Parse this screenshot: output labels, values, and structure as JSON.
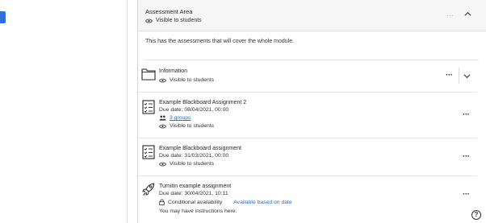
{
  "folder": {
    "title": "Assessment Area",
    "visibility": "Visible to students",
    "description": "This has the assessments that will cover the whole module."
  },
  "items": [
    {
      "title": "Information",
      "visibility": "Visible to students",
      "icon": "folder-icon"
    },
    {
      "title": "Example Blackboard Assignment 2",
      "due": "Due date: 08/04/2021, 00:00",
      "groups": "3 groups",
      "visibility": "Visible to students",
      "icon": "assignment-icon"
    },
    {
      "title": "Example Blackboard assignment",
      "due": "Due date: 31/03/2021, 00:00",
      "visibility": "Visible to students",
      "icon": "assignment-icon"
    },
    {
      "title": "Turnitin example assignment",
      "due": "Due date: 30/04/2021, 10:11",
      "availability": "Conditional availability",
      "availability_link": "Available based on date",
      "instructions": "You may have instructions here.",
      "icon": "rocket-icon"
    }
  ],
  "help": "?",
  "colors": {
    "accent": "#2f6fde",
    "link": "#2b6cc4"
  }
}
